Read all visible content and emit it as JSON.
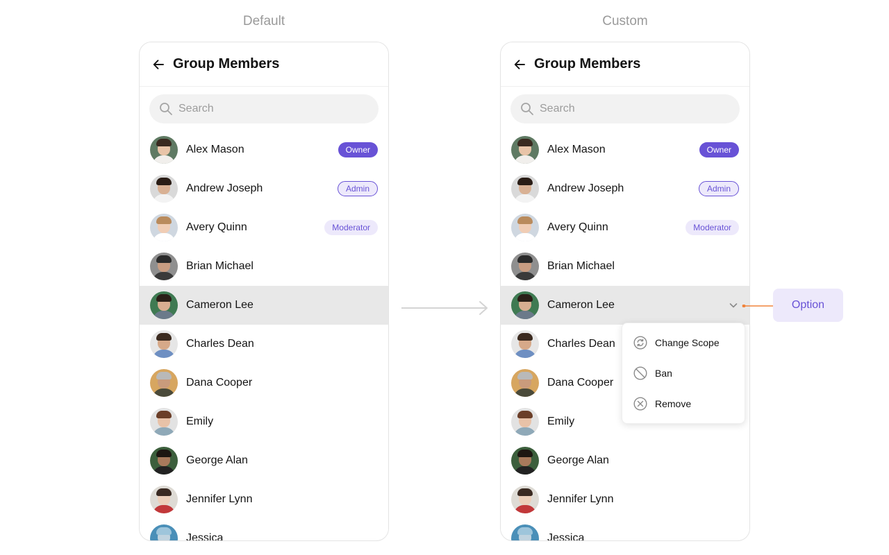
{
  "labels": {
    "default": "Default",
    "custom": "Custom"
  },
  "panel": {
    "title": "Group Members",
    "search_placeholder": "Search"
  },
  "members": [
    {
      "name": "Alex Mason",
      "badge": "Owner",
      "badge_style": "owner"
    },
    {
      "name": "Andrew Joseph",
      "badge": "Admin",
      "badge_style": "admin"
    },
    {
      "name": "Avery Quinn",
      "badge": "Moderator",
      "badge_style": "moderator"
    },
    {
      "name": "Brian Michael",
      "badge": "",
      "badge_style": ""
    },
    {
      "name": "Cameron Lee",
      "badge": "",
      "badge_style": "",
      "selected": true
    },
    {
      "name": "Charles Dean",
      "badge": "",
      "badge_style": ""
    },
    {
      "name": "Dana Cooper",
      "badge": "",
      "badge_style": ""
    },
    {
      "name": "Emily",
      "badge": "",
      "badge_style": ""
    },
    {
      "name": "George Alan",
      "badge": "",
      "badge_style": ""
    },
    {
      "name": "Jennifer Lynn",
      "badge": "",
      "badge_style": ""
    },
    {
      "name": "Jessica",
      "badge": "",
      "badge_style": ""
    }
  ],
  "avatars": [
    {
      "bg": "#5f7a63",
      "skin": "#e8c4a8",
      "hair": "#3a2a20",
      "body": "#f1efec"
    },
    {
      "bg": "#d9d9d9",
      "skin": "#d9b194",
      "hair": "#2a1d16",
      "body": "#f3f3f3"
    },
    {
      "bg": "#cfd7e0",
      "skin": "#f0cdb5",
      "hair": "#b98b5d",
      "body": "#ffffff"
    },
    {
      "bg": "#8f8f8f",
      "skin": "#c99d82",
      "hair": "#2b2b2b",
      "body": "#3a3a3a"
    },
    {
      "bg": "#3f7a52",
      "skin": "#d8ae91",
      "hair": "#2b1f18",
      "body": "#6b7a8a"
    },
    {
      "bg": "#e6e6e6",
      "skin": "#d6a989",
      "hair": "#3b2a1f",
      "body": "#6e8fc2"
    },
    {
      "bg": "#d7a660",
      "skin": "#c99b7c",
      "hair": "#b9b9b9",
      "body": "#4a4a3a"
    },
    {
      "bg": "#e2e2e2",
      "skin": "#e8c2a8",
      "hair": "#6b3e28",
      "body": "#8fa9b8"
    },
    {
      "bg": "#3c5f3c",
      "skin": "#a87a5c",
      "hair": "#1e1712",
      "body": "#222222"
    },
    {
      "bg": "#dedbd5",
      "skin": "#eccfba",
      "hair": "#3a2a22",
      "body": "#c2383a"
    },
    {
      "bg": "#4a8fb8",
      "skin": "#c0d3df",
      "hair": "#9ec5db",
      "body": "#2f6d93"
    }
  ],
  "menu": {
    "items": [
      {
        "label": "Change Scope",
        "icon": "change-scope-icon"
      },
      {
        "label": "Ban",
        "icon": "ban-icon"
      },
      {
        "label": "Remove",
        "icon": "remove-icon"
      }
    ]
  },
  "callout": {
    "label": "Option"
  },
  "colors": {
    "accent": "#6852d6",
    "accent_light": "#ede9fb",
    "selected_row": "#e8e8e8",
    "connector": "#f0843c"
  }
}
